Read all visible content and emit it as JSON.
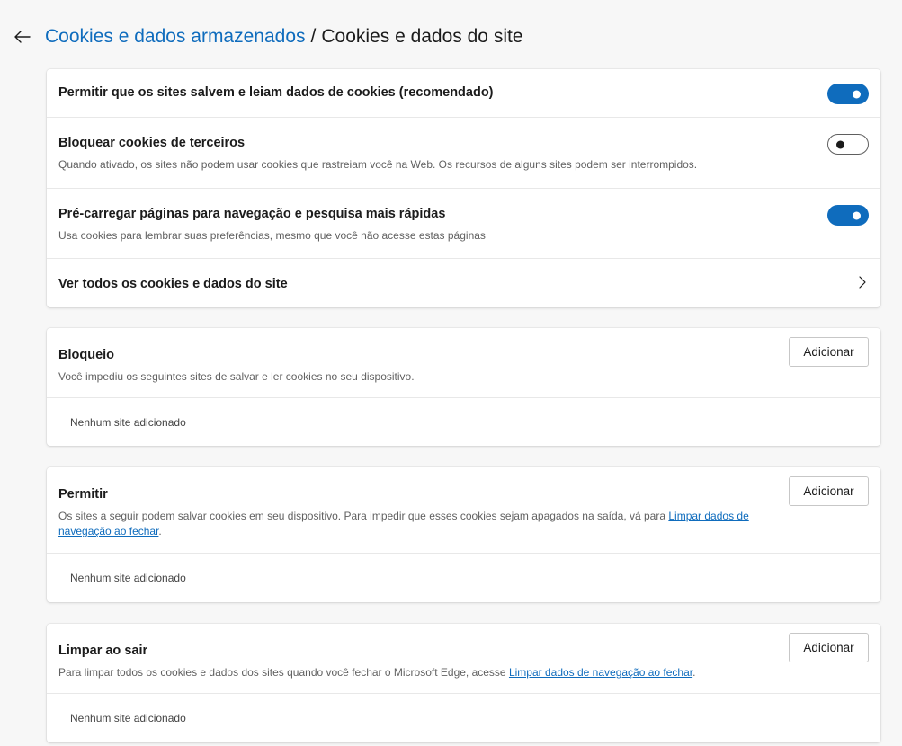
{
  "header": {
    "breadcrumb_parent": "Cookies e dados armazenados",
    "separator": "/",
    "breadcrumb_current": "Cookies e dados do site"
  },
  "settings": {
    "allow_cookies": {
      "title": "Permitir que os sites salvem e leiam dados de cookies (recomendado)",
      "enabled": true
    },
    "block_third_party": {
      "title": "Bloquear cookies de terceiros",
      "description": "Quando ativado, os sites não podem usar cookies que rastreiam você na Web. Os recursos de alguns sites podem ser interrompidos.",
      "enabled": false
    },
    "preload": {
      "title": "Pré-carregar páginas para navegação e pesquisa mais rápidas",
      "description": "Usa cookies para lembrar suas preferências, mesmo que você não acesse estas páginas",
      "enabled": true
    },
    "see_all": {
      "title": "Ver todos os cookies e dados do site"
    }
  },
  "block_section": {
    "title": "Bloqueio",
    "description": "Você impediu os seguintes sites de salvar e ler cookies no seu dispositivo.",
    "add_label": "Adicionar",
    "empty_text": "Nenhum site adicionado"
  },
  "allow_section": {
    "title": "Permitir",
    "description": "Os sites a seguir podem salvar cookies em seu dispositivo. Para impedir que esses cookies sejam apagados na saída, vá para ",
    "link_text": "Limpar dados de navegação ao fechar",
    "description_end": ".",
    "add_label": "Adicionar",
    "empty_text": "Nenhum site adicionado"
  },
  "clear_section": {
    "title": "Limpar ao sair",
    "description": "Para limpar todos os cookies e dados dos sites quando você fechar o Microsoft Edge, acesse ",
    "link_text": "Limpar dados de navegação ao fechar",
    "description_end": ".",
    "add_label": "Adicionar",
    "empty_text": "Nenhum site adicionado"
  },
  "colors": {
    "accent": "#0f6cbd",
    "background": "#f7f7f7",
    "card": "#ffffff"
  },
  "icons": {
    "back": "back-arrow-icon",
    "chevron": "chevron-right-icon"
  }
}
